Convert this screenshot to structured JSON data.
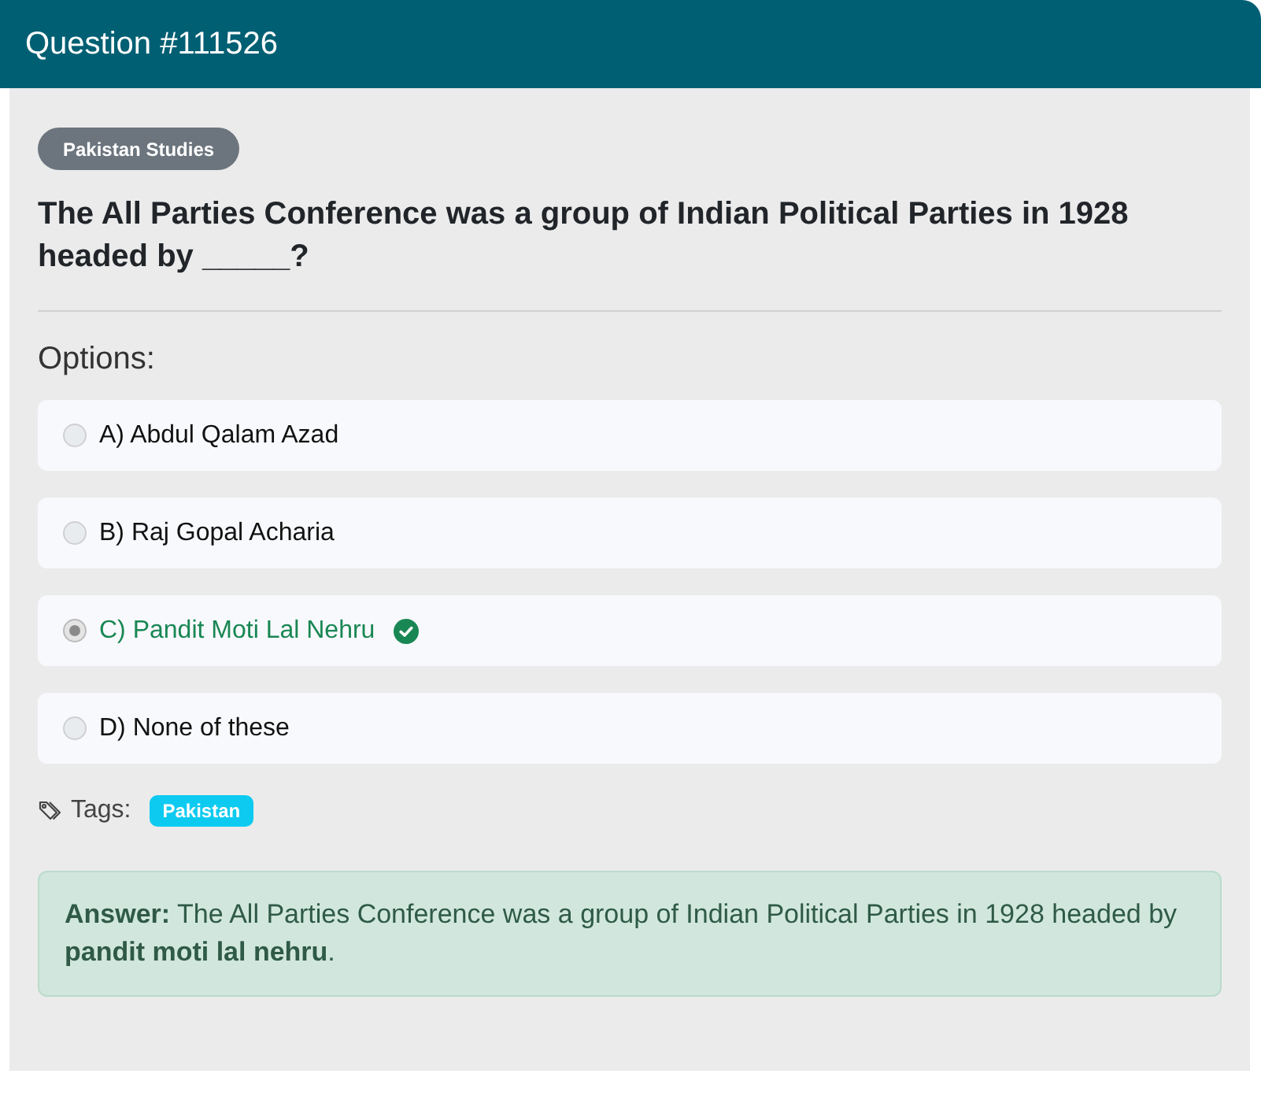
{
  "header": {
    "title": "Question #111526"
  },
  "category_badge": "Pakistan Studies",
  "question": "The All Parties Conference was a group of Indian Political Parties in 1928 headed by _____?",
  "options_label": "Options:",
  "options": [
    {
      "label": "A) Abdul Qalam Azad",
      "selected": false,
      "correct": false
    },
    {
      "label": "B) Raj Gopal Acharia",
      "selected": false,
      "correct": false
    },
    {
      "label": "C) Pandit Moti Lal Nehru",
      "selected": true,
      "correct": true
    },
    {
      "label": "D) None of these",
      "selected": false,
      "correct": false
    }
  ],
  "tags_label": "Tags:",
  "tags": [
    "Pakistan"
  ],
  "answer": "**Answer:** The All Parties Conference was a group of Indian Political Parties in 1928 headed by **pandit moti lal nehru**."
}
